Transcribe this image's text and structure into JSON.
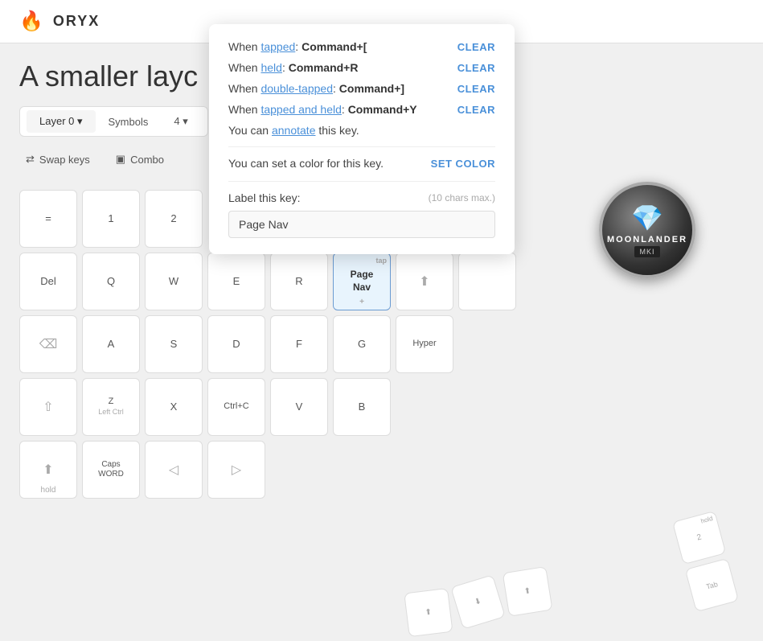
{
  "header": {
    "logo_text": "ORYX",
    "logo_icon": "🔥"
  },
  "page": {
    "title": "A smaller layc",
    "tabs": [
      {
        "label": "Layer 0 ▾",
        "active": true
      },
      {
        "label": "Symbols",
        "active": false
      },
      {
        "label": "4 ▾",
        "active": false
      }
    ],
    "toolbar": [
      {
        "label": "Swap keys",
        "icon": "swap"
      },
      {
        "label": "Combo",
        "icon": "combo"
      }
    ]
  },
  "popup": {
    "rows": [
      {
        "prefix": "When ",
        "link": "tapped",
        "suffix": ": ",
        "cmd": "Command+[",
        "clear": "CLEAR"
      },
      {
        "prefix": "When ",
        "link": "held",
        "suffix": ": ",
        "cmd": "Command+R",
        "clear": "CLEAR"
      },
      {
        "prefix": "When ",
        "link": "double-tapped",
        "suffix": ": ",
        "cmd": "Command+]",
        "clear": "CLEAR"
      },
      {
        "prefix": "When ",
        "link": "tapped and held",
        "suffix": ": ",
        "cmd": "Command+Y",
        "clear": "CLEAR"
      }
    ],
    "annotate_text": "You can ",
    "annotate_link": "annotate",
    "annotate_suffix": " this key.",
    "color_text": "You can set a color for this key.",
    "set_color_label": "SET COLOR",
    "label_text": "Label this key:",
    "label_hint": "(10 chars max.)",
    "label_value": "Page Nav",
    "label_placeholder": "Page Nav"
  },
  "keys": {
    "row1": [
      "=",
      "1",
      "2"
    ],
    "row2_labels": [
      "Del",
      "Q",
      "W",
      "E",
      "R",
      "Page Nav",
      "",
      ""
    ],
    "row3_labels": [
      "",
      "A",
      "S",
      "D",
      "F",
      "G",
      "Hyper"
    ],
    "row4_labels": [
      "",
      "Z",
      "X",
      "Ctrl+C",
      "V",
      "B"
    ],
    "row5_labels": [
      "",
      "Caps WORD",
      "",
      "",
      ""
    ],
    "bottom_labels": [
      "",
      "hold"
    ],
    "page_nav_tap": "tap",
    "page_nav_plus": "+"
  },
  "badge": {
    "title": "MOONLANDER",
    "subtitle": "MKI"
  },
  "colors": {
    "accent": "#4a90d9",
    "orange": "#f07020",
    "highlight_bg": "#e8f4fd",
    "highlight_border": "#6b9bd2"
  }
}
